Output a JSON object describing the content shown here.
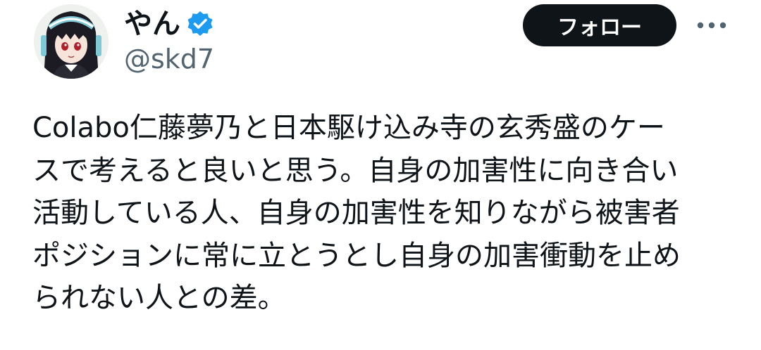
{
  "author": {
    "display_name": "やん",
    "handle": "@skd7",
    "verified": true,
    "avatar_icon": "anime-character-avatar",
    "verified_icon": "verified-badge-icon"
  },
  "actions": {
    "follow_label": "フォロー",
    "more_icon": "more-options-icon"
  },
  "tweet": {
    "lines": [
      "Colabo仁藤夢乃と日本駆け込み寺の玄秀盛のケー",
      "スで考えると良いと思う。自身の加害性に向き合い",
      "活動している人、自身の加害性を知りながら被害者",
      "ポジションに常に立とうとし自身の加害衝動を止め",
      "られない人との差。"
    ]
  },
  "colors": {
    "text": "#0f1419",
    "secondary_text": "#536471",
    "follow_bg": "#0f1419",
    "follow_text": "#ffffff",
    "verified": "#1d9bf0"
  }
}
